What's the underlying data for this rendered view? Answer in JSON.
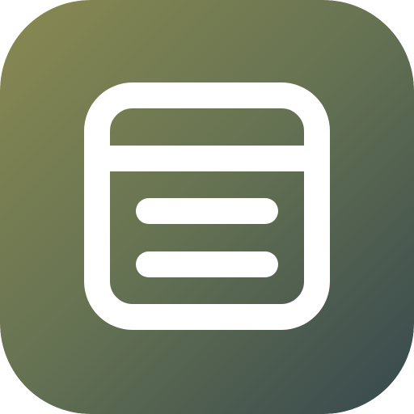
{
  "app_icon": {
    "icon": "window-list-icon",
    "colors": {
      "gradient_start": "#8A8A52",
      "gradient_mid": "#647152",
      "gradient_end": "#36484E",
      "glyph": "#FFFFFF"
    }
  }
}
